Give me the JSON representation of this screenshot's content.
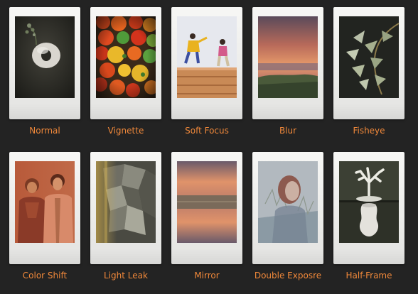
{
  "accent_color": "#f0883a",
  "background_color": "#232323",
  "filters": [
    {
      "label": "Normal",
      "thumbnail": "vase-and-flower"
    },
    {
      "label": "Vignette",
      "thumbnail": "tomatoes"
    },
    {
      "label": "Soft Focus",
      "thumbnail": "jumping-people"
    },
    {
      "label": "Blur",
      "thumbnail": "sunset-beach"
    },
    {
      "label": "Fisheye",
      "thumbnail": "leaves"
    },
    {
      "label": "Color Shift",
      "thumbnail": "couple-portrait"
    },
    {
      "label": "Light Leak",
      "thumbnail": "abstract-sculpture"
    },
    {
      "label": "Mirror",
      "thumbnail": "sunset-sea-mirror"
    },
    {
      "label": "Double Exposre",
      "thumbnail": "woman-double-exposure"
    },
    {
      "label": "Half-Frame",
      "thumbnail": "coral-and-vase"
    }
  ]
}
